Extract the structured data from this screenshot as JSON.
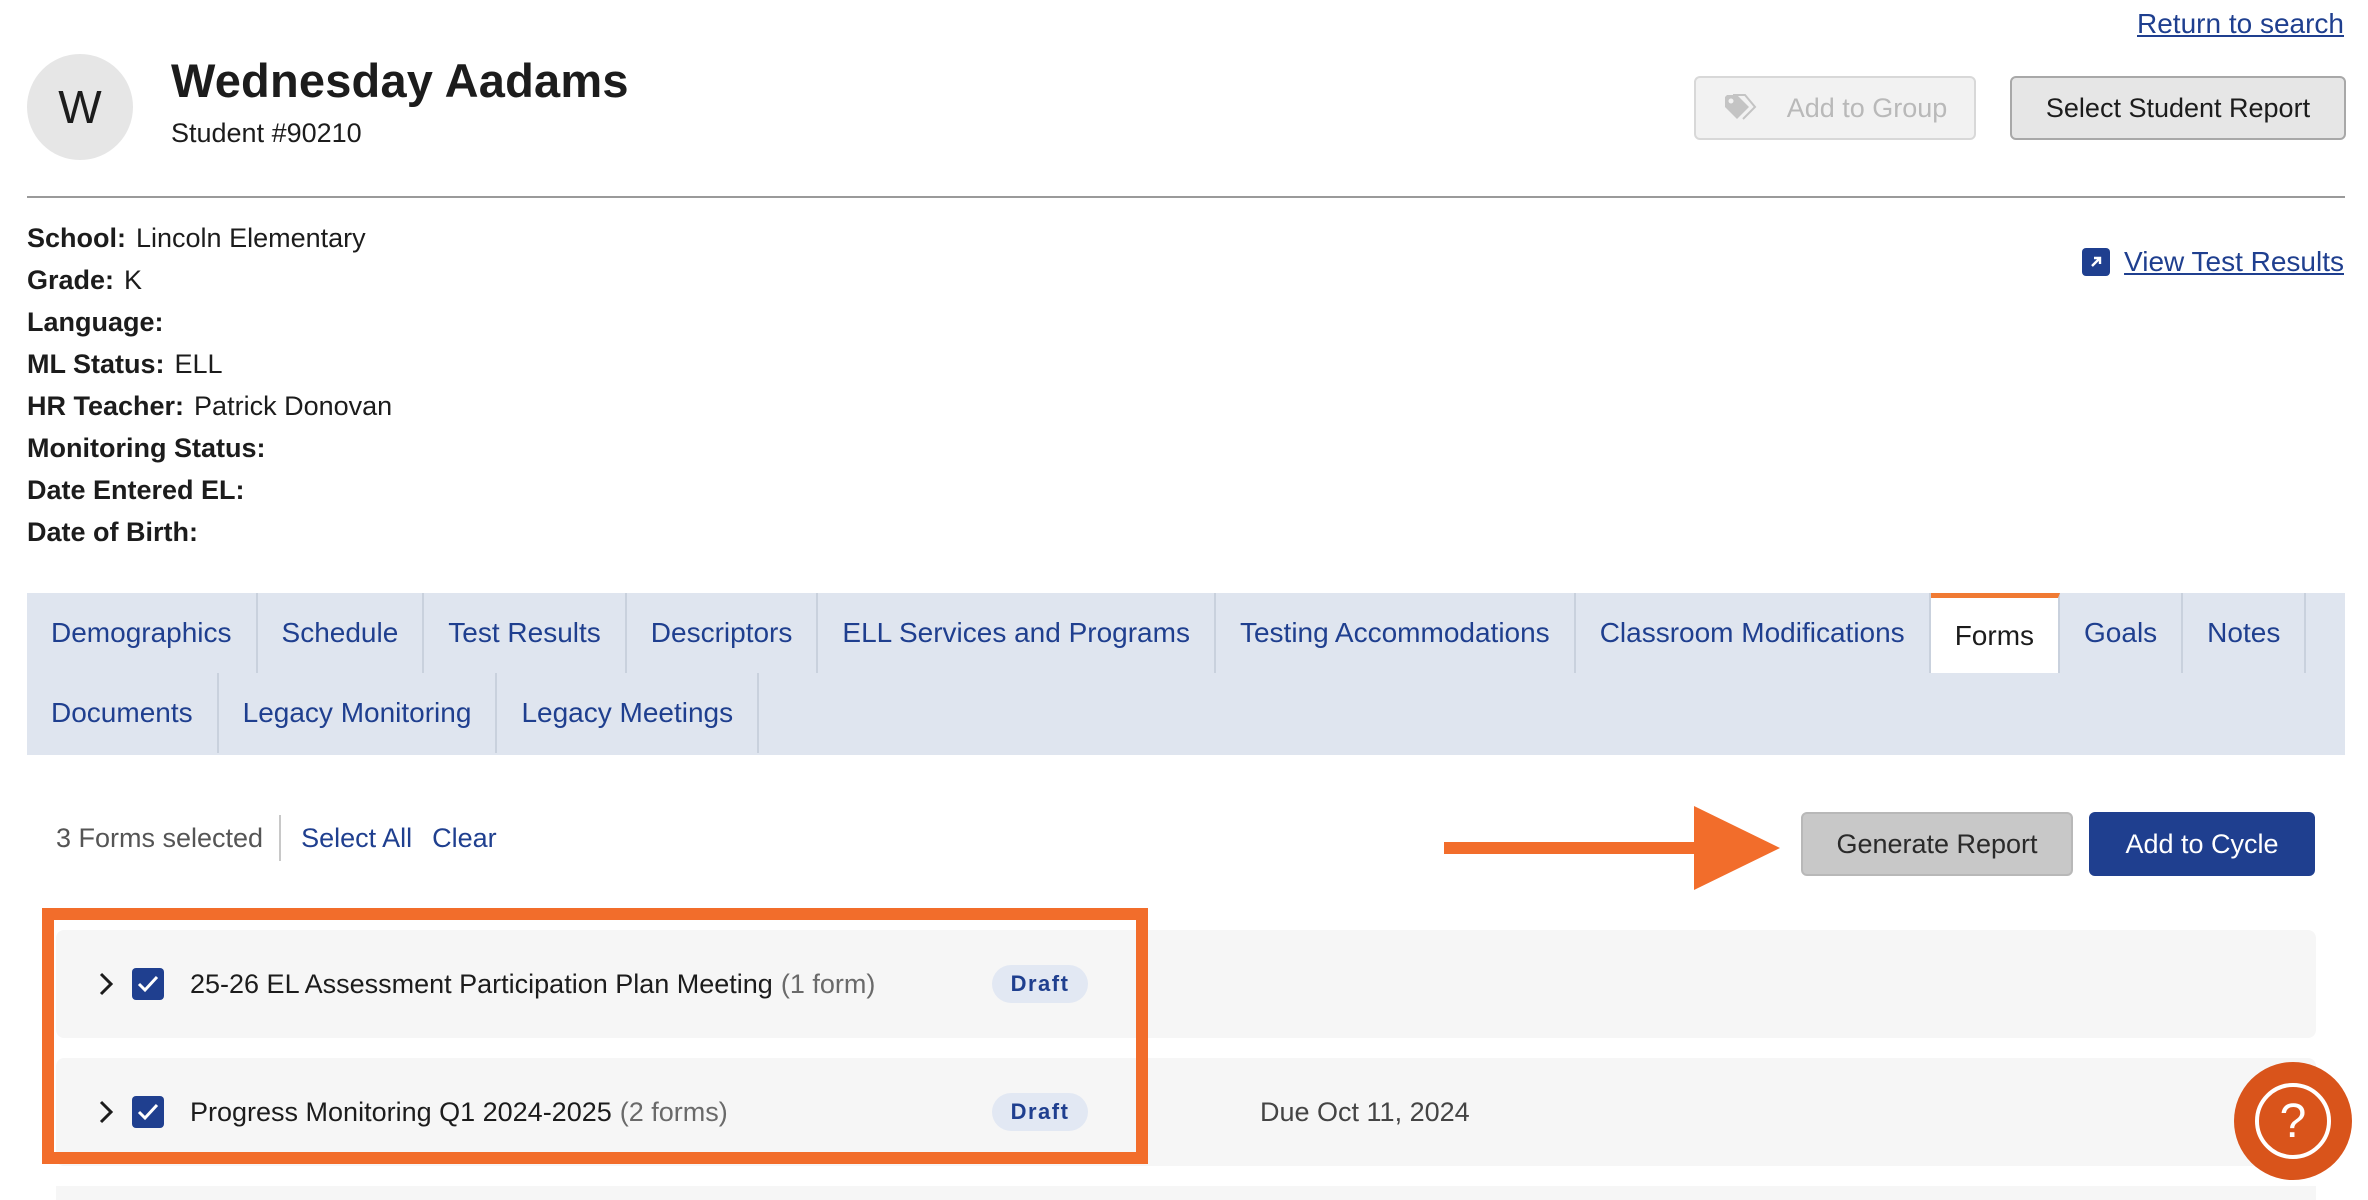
{
  "top": {
    "return_link": "Return to search"
  },
  "student": {
    "initial": "W",
    "name": "Wednesday Aadams",
    "number": "Student #90210"
  },
  "header_buttons": {
    "add_to_group": "Add to Group",
    "select_report": "Select Student Report"
  },
  "info": [
    {
      "label": "School:",
      "value": "Lincoln Elementary"
    },
    {
      "label": "Grade:",
      "value": "K"
    },
    {
      "label": "Language:",
      "value": ""
    },
    {
      "label": "ML Status:",
      "value": "ELL"
    },
    {
      "label": "HR Teacher:",
      "value": "Patrick Donovan"
    },
    {
      "label": "Monitoring Status:",
      "value": ""
    },
    {
      "label": "Date Entered EL:",
      "value": ""
    },
    {
      "label": "Date of Birth:",
      "value": ""
    }
  ],
  "view_test_results": "View Test Results",
  "tabs": {
    "row1": [
      "Demographics",
      "Schedule",
      "Test Results",
      "Descriptors",
      "ELL Services and Programs",
      "Testing Accommodations",
      "Classroom Modifications",
      "Forms",
      "Goals",
      "Notes"
    ],
    "row2": [
      "Documents",
      "Legacy Monitoring",
      "Legacy Meetings"
    ],
    "active": "Forms"
  },
  "selection": {
    "count_text": "3 Forms selected",
    "select_all": "Select All",
    "clear": "Clear"
  },
  "actions": {
    "generate_report": "Generate Report",
    "add_to_cycle": "Add to Cycle"
  },
  "forms": [
    {
      "title": "25-26 EL Assessment Participation Plan Meeting",
      "count": "(1 form)",
      "status": "Draft",
      "due": "",
      "checked": true
    },
    {
      "title": "Progress Monitoring Q1 2024-2025",
      "count": "(2 forms)",
      "status": "Draft",
      "due": "Due Oct 11, 2024",
      "checked": true
    }
  ],
  "help": "?",
  "colors": {
    "brand_blue": "#1f3f8f",
    "annotation_orange": "#f26d2b",
    "help_orange": "#d9541b",
    "tab_bg": "#dfe5ef"
  },
  "icons": [
    "tag-icon",
    "external-link-icon",
    "chevron-right-icon",
    "checkbox-checked-icon",
    "annotation-arrow",
    "help-icon"
  ]
}
